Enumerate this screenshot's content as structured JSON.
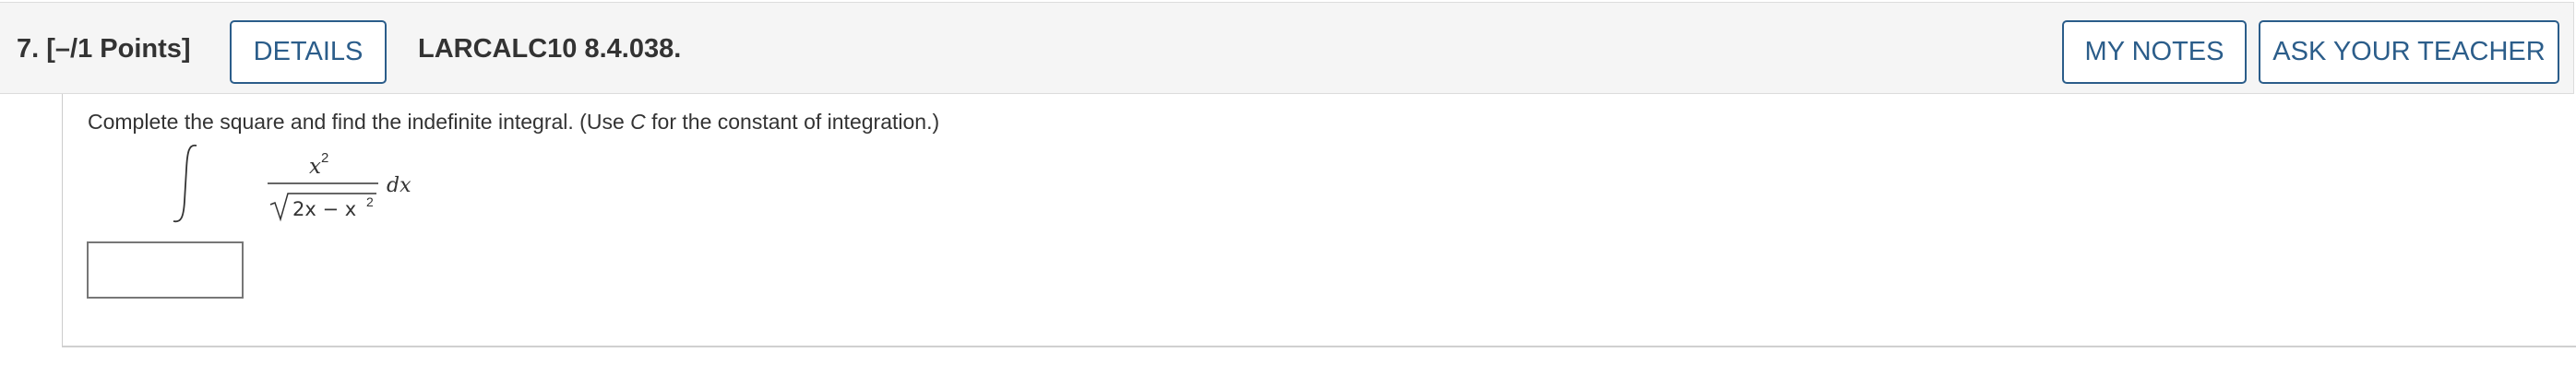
{
  "question": {
    "number_label": "7.",
    "points_label": "[–/1 Points]",
    "details_label": "DETAILS",
    "code": "LARCALC10 8.4.038.",
    "my_notes_label": "MY NOTES",
    "ask_teacher_label": "ASK YOUR TEACHER"
  },
  "problem": {
    "prompt_before": "Complete the square and find the indefinite integral. (Use ",
    "prompt_var": "C",
    "prompt_after": " for the constant of integration.)",
    "integrand_numerator_base": "x",
    "integrand_numerator_exp": "2",
    "integrand_denominator": "2x − x",
    "integrand_denominator_exp": "2",
    "differential": "dx",
    "answer_value": ""
  }
}
